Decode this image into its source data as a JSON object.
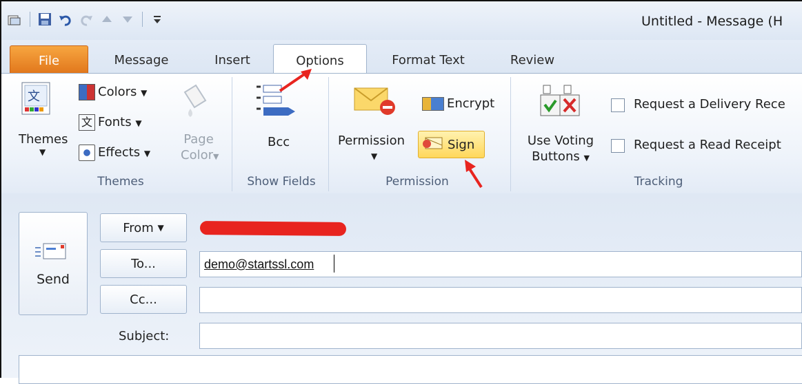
{
  "window": {
    "title": "Untitled - Message (H"
  },
  "quick_access": {
    "icons": [
      "outlook-icon",
      "save-icon",
      "undo-icon",
      "redo-icon",
      "up-icon",
      "down-icon",
      "customize-icon"
    ]
  },
  "tabs": [
    {
      "label": "File"
    },
    {
      "label": "Message"
    },
    {
      "label": "Insert"
    },
    {
      "label": "Options",
      "active": true
    },
    {
      "label": "Format Text"
    },
    {
      "label": "Review"
    }
  ],
  "ribbon": {
    "themes_group": {
      "label": "Themes",
      "themes_button": "Themes",
      "colors": "Colors",
      "fonts": "Fonts",
      "effects": "Effects",
      "page_color_line1": "Page",
      "page_color_line2": "Color"
    },
    "show_fields_group": {
      "label": "Show Fields",
      "bcc": "Bcc"
    },
    "permission_group": {
      "label": "Permission",
      "permission": "Permission",
      "encrypt": "Encrypt",
      "sign": "Sign"
    },
    "tracking_group": {
      "label": "Tracking",
      "voting_line1": "Use Voting",
      "voting_line2": "Buttons",
      "delivery_receipt": "Request a Delivery Rece",
      "read_receipt": "Request a Read Receipt"
    }
  },
  "compose": {
    "send": "Send",
    "from": "From",
    "to": "To...",
    "cc": "Cc...",
    "subject_label": "Subject:",
    "to_value": "demo@startssl.com",
    "cc_value": "",
    "subject_value": ""
  },
  "colors": {
    "accent_file": "#e0741a",
    "annotation_red": "#e8241f",
    "sign_highlight": "#ffd75a"
  }
}
